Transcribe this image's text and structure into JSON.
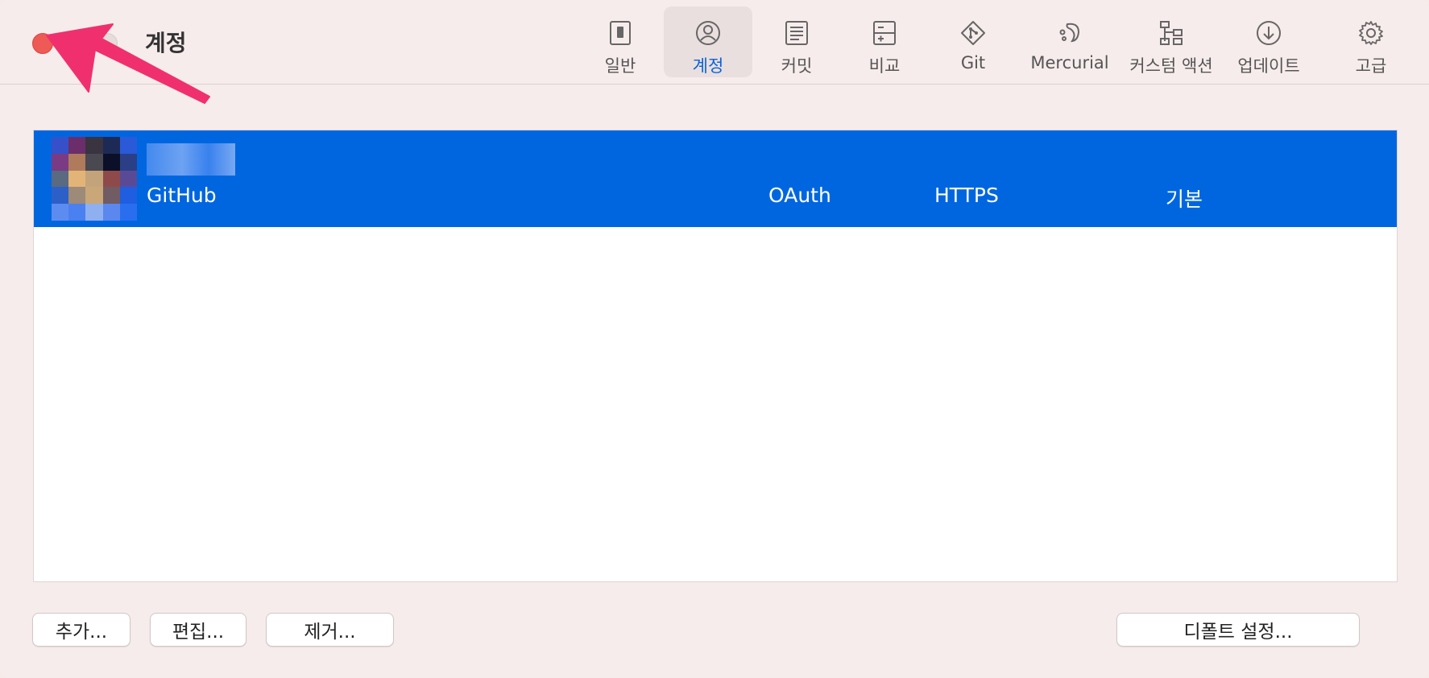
{
  "window": {
    "title": "계정"
  },
  "toolbar": {
    "tabs": [
      {
        "label": "일반",
        "icon": "general-icon",
        "active": false
      },
      {
        "label": "계정",
        "icon": "account-icon",
        "active": true
      },
      {
        "label": "커밋",
        "icon": "commit-icon",
        "active": false
      },
      {
        "label": "비교",
        "icon": "diff-icon",
        "active": false
      },
      {
        "label": "Git",
        "icon": "git-icon",
        "active": false
      },
      {
        "label": "Mercurial",
        "icon": "mercurial-icon",
        "active": false
      },
      {
        "label": "커스텀 액션",
        "icon": "custom-action-icon",
        "active": false
      },
      {
        "label": "업데이트",
        "icon": "update-icon",
        "active": false
      },
      {
        "label": "고급",
        "icon": "gear-icon",
        "active": false
      }
    ]
  },
  "accounts": {
    "rows": [
      {
        "host": "GitHub",
        "auth": "OAuth",
        "protocol": "HTTPS",
        "default": "기본",
        "selected": true
      }
    ]
  },
  "buttons": {
    "add": "추가...",
    "edit": "편집...",
    "remove": "제거...",
    "set_default": "디폴트 설정..."
  },
  "colors": {
    "selection": "#0066e0",
    "accent": "#0a63d8",
    "annotation_arrow": "#f0306e",
    "close": "#ee5a55"
  }
}
